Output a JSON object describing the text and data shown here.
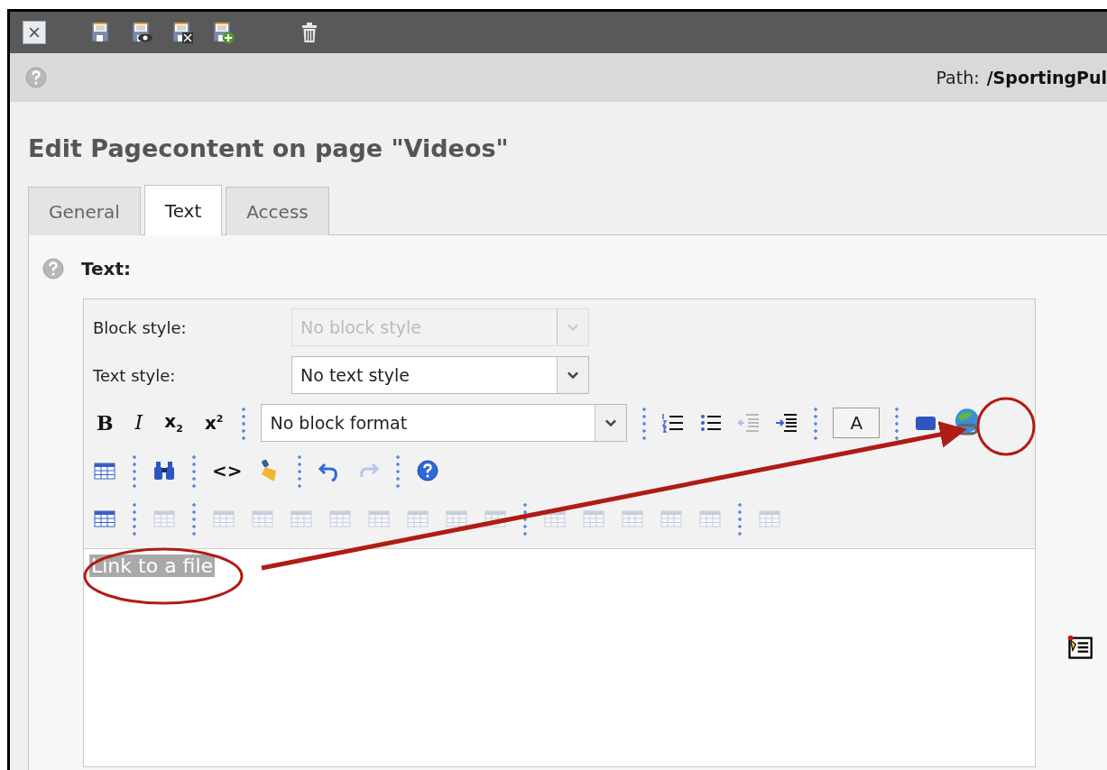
{
  "path": {
    "label": "Path:",
    "value": "/SportingPul"
  },
  "title": "Edit Pagecontent on page \"Videos\"",
  "tabs": [
    {
      "label": "General",
      "selected": false
    },
    {
      "label": "Text",
      "selected": true
    },
    {
      "label": "Access",
      "selected": false
    }
  ],
  "field": {
    "label": "Text:"
  },
  "editor": {
    "block_style": {
      "label": "Block style:",
      "value": "No block style",
      "disabled": true
    },
    "text_style": {
      "label": "Text style:",
      "value": "No text style",
      "disabled": false
    },
    "format_buttons": [
      "B",
      "I",
      "x$_{2}$",
      "x$^{2}$"
    ],
    "block_format": "No block format",
    "font_color_button": "A",
    "code_button": "<>",
    "content": {
      "text": "Link to a file",
      "selected": true
    }
  }
}
